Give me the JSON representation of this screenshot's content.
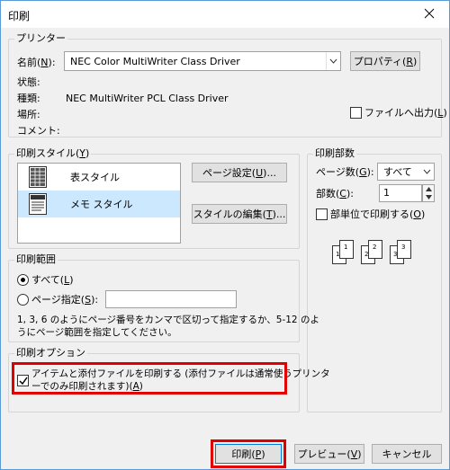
{
  "window": {
    "title": "印刷"
  },
  "printer": {
    "group_title": "プリンター",
    "name_label": "名前(",
    "name_key": "N",
    "name_label_end": "):",
    "name_value": "NEC Color MultiWriter Class Driver",
    "properties_label": "プロパティ(",
    "properties_key": "R",
    "properties_end": ")",
    "status_label": "状態:",
    "type_label": "種類:",
    "type_value": "NEC MultiWriter PCL Class Driver",
    "location_label": "場所:",
    "comment_label": "コメント:",
    "print_to_file_label": "ファイルへ出力(",
    "print_to_file_key": "L",
    "print_to_file_end": ")",
    "print_to_file_checked": false
  },
  "print_style": {
    "group_title": "印刷スタイル(",
    "group_key": "Y",
    "group_end": ")",
    "items": [
      {
        "label": "表スタイル",
        "selected": false
      },
      {
        "label": "メモ スタイル",
        "selected": true
      }
    ],
    "page_setup_label": "ページ設定(",
    "page_setup_key": "U",
    "page_setup_end": ")...",
    "edit_styles_label": "スタイルの編集(",
    "edit_styles_key": "T",
    "edit_styles_end": ")..."
  },
  "copies": {
    "group_title": "印刷部数",
    "pages_label": "ページ数(",
    "pages_key": "G",
    "pages_end": "):",
    "pages_value": "すべて",
    "copies_label": "部数(",
    "copies_key": "C",
    "copies_end": "):",
    "copies_value": "1",
    "collate_label": "部単位で印刷する(",
    "collate_key": "O",
    "collate_end": ")",
    "collate_checked": false,
    "collate_pages": [
      "1",
      "1",
      "2",
      "2",
      "3",
      "3"
    ]
  },
  "range": {
    "group_title": "印刷範囲",
    "all_label": "すべて(",
    "all_key": "L",
    "all_end": ")",
    "all_selected": true,
    "pages_label": "ページ指定(",
    "pages_key": "S",
    "pages_end": "):",
    "pages_value": "",
    "hint_line1": "1, 3, 6 のようにページ番号をカンマで区切って指定するか、5-12 のよ",
    "hint_line2": "うにページ範囲を指定してください。"
  },
  "options": {
    "group_title": "印刷オプション",
    "attach_line1": "アイテムと添付ファイルを印刷する (添付ファイルは通常使うプリンタ",
    "attach_line2_a": "ーでのみ印刷されます)(",
    "attach_key": "A",
    "attach_line2_end": ")",
    "attach_checked": true
  },
  "footer": {
    "print_label": "印刷(",
    "print_key": "P",
    "print_end": ")",
    "preview_label": "プレビュー(",
    "preview_key": "V",
    "preview_end": ")",
    "cancel_label": "キャンセル"
  },
  "colors": {
    "highlight": "#e00000",
    "selection": "#cce8ff",
    "accent": "#0078d7"
  }
}
